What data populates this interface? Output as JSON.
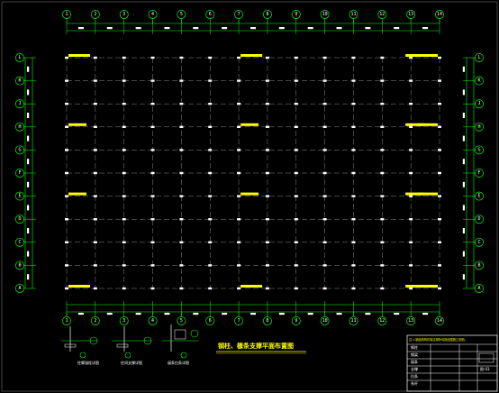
{
  "colors": {
    "background": "#000000",
    "grid_bubble": "#00ff00",
    "dim_line": "#00ff00",
    "column": "#ffffff",
    "beam_dash": "#8a8a8a",
    "tag": "#ffff00",
    "title": "#ffff00",
    "frame": "#ffffff"
  },
  "grid_columns": [
    "1",
    "2",
    "3",
    "4",
    "5",
    "6",
    "7",
    "8",
    "9",
    "10",
    "11",
    "12",
    "13",
    "14"
  ],
  "grid_rows": [
    "L",
    "K",
    "J",
    "H",
    "G",
    "F",
    "E",
    "D",
    "C",
    "B",
    "A"
  ],
  "plan_title": "钢柱、檩条支撑平面布置图",
  "details": [
    {
      "label": "柱脚锚栓详图"
    },
    {
      "label": "柱间支撑详图"
    },
    {
      "label": "檩条拉条详图"
    }
  ],
  "title_block": {
    "note": "注:1.钢结构构件除注明外均按此图施工说明。",
    "cells": [
      "钢柱",
      "钢梁",
      "檩条",
      "支撑",
      "拉条",
      "系杆"
    ],
    "page_ref": "图-03"
  }
}
